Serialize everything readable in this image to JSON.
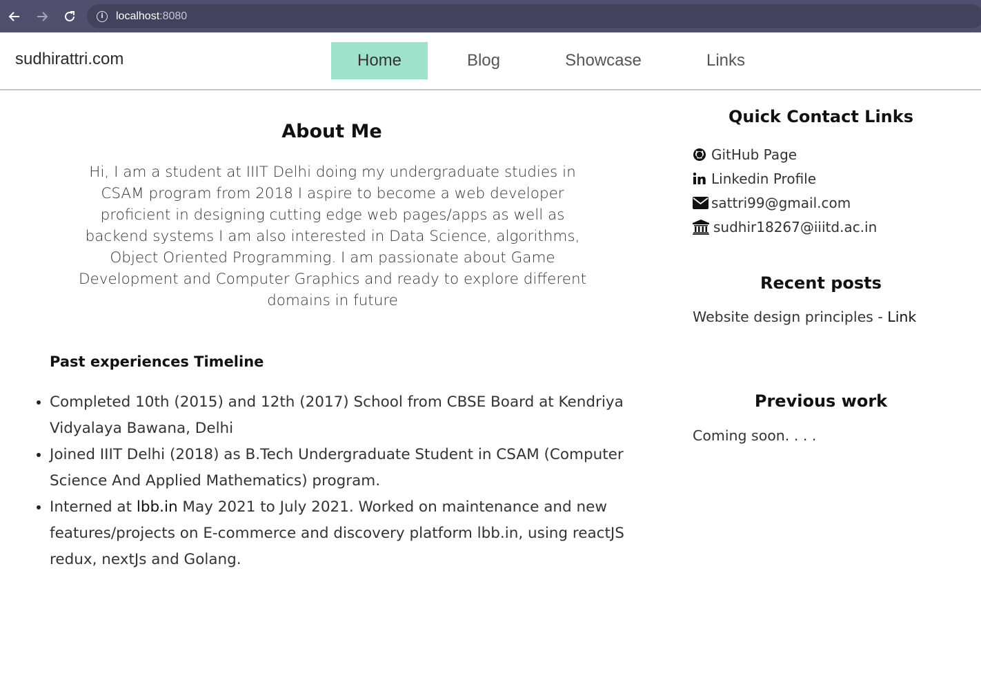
{
  "browser": {
    "url_host": "localhost",
    "url_port": ":8080",
    "icons": [
      "back-arrow-icon",
      "forward-arrow-icon",
      "reload-icon",
      "info-icon"
    ]
  },
  "header": {
    "brand": "sudhirattri.com",
    "nav": [
      {
        "label": "Home",
        "active": true
      },
      {
        "label": "Blog",
        "active": false
      },
      {
        "label": "Showcase",
        "active": false
      },
      {
        "label": "Links",
        "active": false
      }
    ],
    "accent_color": "#9fe2cc"
  },
  "about": {
    "title": "About Me",
    "text": "Hi, I am a student at IIIT Delhi doing my undergraduate studies in CSAM program from 2018 I aspire to become a web developer proficient in designing cutting edge web pages/apps as well as backend systems I am also interested in Data Science, algorithms, Object Oriented Programming. I am passionate about Game Development and Computer Graphics and ready to explore different domains in future"
  },
  "timeline": {
    "title": "Past experiences Timeline",
    "items": [
      {
        "text": "Completed 10th (2015) and 12th (2017) School from CBSE Board at Kendriya Vidyalaya Bawana, Delhi"
      },
      {
        "text": "Joined IIIT Delhi (2018) as B.Tech Undergraduate Student in CSAM (Computer Science And Applied Mathematics) program."
      },
      {
        "prefix": "Interned at ",
        "link": "lbb.in",
        "suffix": " May 2021 to July 2021. Worked on maintenance and new features/projects on E-commerce and discovery platform lbb.in, using reactJS redux, nextJs and Golang."
      }
    ]
  },
  "sidebar": {
    "contact_title": "Quick Contact Links",
    "contacts": [
      {
        "icon": "github-icon",
        "label": "GitHub Page"
      },
      {
        "icon": "linkedin-icon",
        "label": "Linkedin Profile"
      },
      {
        "icon": "envelope-icon",
        "label": "sattri99@gmail.com"
      },
      {
        "icon": "university-icon",
        "label": "sudhir18267@iiitd.ac.in"
      }
    ],
    "recent_title": "Recent posts",
    "recent_post": {
      "title": "Website design principles",
      "separator": " - ",
      "link": "Link"
    },
    "prev_title": "Previous work",
    "prev_text": "Coming soon. . . ."
  }
}
